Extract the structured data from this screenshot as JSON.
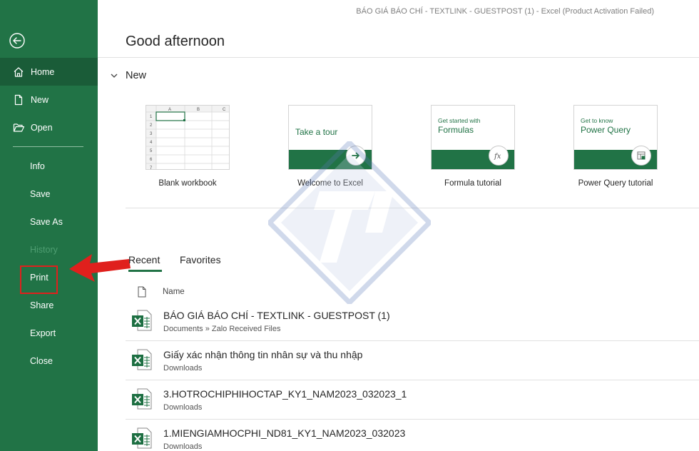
{
  "window_title": "BÁO GIÁ BÁO CHÍ - TEXTLINK - GUESTPOST  (1)  -  Excel (Product Activation Failed)",
  "greeting": "Good afternoon",
  "sidebar": {
    "back_icon": "back-arrow-icon",
    "items": [
      {
        "label": "Home",
        "icon": "home-icon"
      },
      {
        "label": "New",
        "icon": "new-document-icon"
      },
      {
        "label": "Open",
        "icon": "open-folder-icon"
      },
      {
        "label": "Info"
      },
      {
        "label": "Save"
      },
      {
        "label": "Save As"
      },
      {
        "label": "History"
      },
      {
        "label": "Print"
      },
      {
        "label": "Share"
      },
      {
        "label": "Export"
      },
      {
        "label": "Close"
      }
    ]
  },
  "new_section": {
    "title": "New",
    "templates": [
      {
        "caption": "Blank workbook",
        "grid_cols": [
          "A",
          "B",
          "C"
        ],
        "grid_rows": [
          "1",
          "2",
          "3",
          "4",
          "5",
          "6",
          "7"
        ]
      },
      {
        "caption": "Welcome to Excel",
        "tile_text": "Take a tour"
      },
      {
        "caption": "Formula tutorial",
        "tile_small": "Get started with",
        "tile_big": "Formulas"
      },
      {
        "caption": "Power Query tutorial",
        "tile_small": "Get to know",
        "tile_big": "Power Query"
      }
    ]
  },
  "tabs": {
    "recent": "Recent",
    "favorites": "Favorites",
    "active": "Recent"
  },
  "files": {
    "header": "Name",
    "rows": [
      {
        "name": "BÁO GIÁ BÁO CHÍ - TEXTLINK - GUESTPOST  (1)",
        "path": "Documents » Zalo Received Files"
      },
      {
        "name": "Giấy xác nhận thông tin nhân sự và thu nhập",
        "path": "Downloads"
      },
      {
        "name": "3.HOTROCHIPHIHOCTAP_KY1_NAM2023_032023_1",
        "path": "Downloads"
      },
      {
        "name": "1.MIENGIAMHOCPHI_ND81_KY1_NAM2023_032023",
        "path": "Downloads"
      }
    ]
  },
  "colors": {
    "excel_green": "#217346",
    "active_nav": "#1a5c38",
    "annotation_red": "#e0201d"
  }
}
